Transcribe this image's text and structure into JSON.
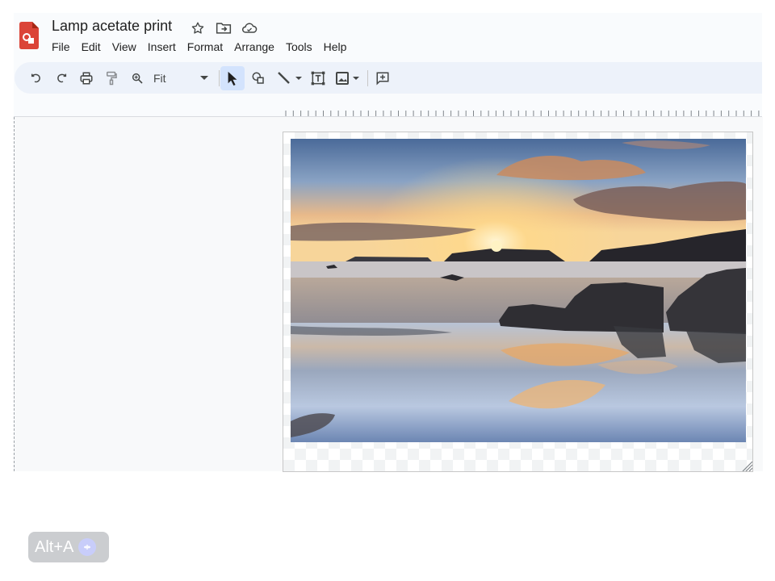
{
  "document": {
    "title": "Lamp acetate print"
  },
  "title_bar": {
    "icons": [
      "star-icon",
      "move-to-folder-icon",
      "cloud-saved-icon"
    ]
  },
  "menu": {
    "items": [
      "File",
      "Edit",
      "View",
      "Insert",
      "Format",
      "Arrange",
      "Tools",
      "Help"
    ]
  },
  "toolbar": {
    "zoom_value": "Fit",
    "tools": [
      "undo-icon",
      "redo-icon",
      "print-icon",
      "paint-format-icon",
      "zoom-icon",
      "select-icon",
      "shape-icon",
      "line-icon",
      "text-box-icon",
      "image-icon",
      "comment-icon"
    ],
    "active_tool": "select"
  },
  "canvas": {
    "image": {
      "alt": "Sunset over beach with rocks and reflections"
    }
  },
  "overlay": {
    "shortcut_label": "Alt+A"
  },
  "colors": {
    "app_icon": "#db4437",
    "toolbar_bg": "#edf2fa",
    "active_tool_bg": "#d3e3fd"
  }
}
